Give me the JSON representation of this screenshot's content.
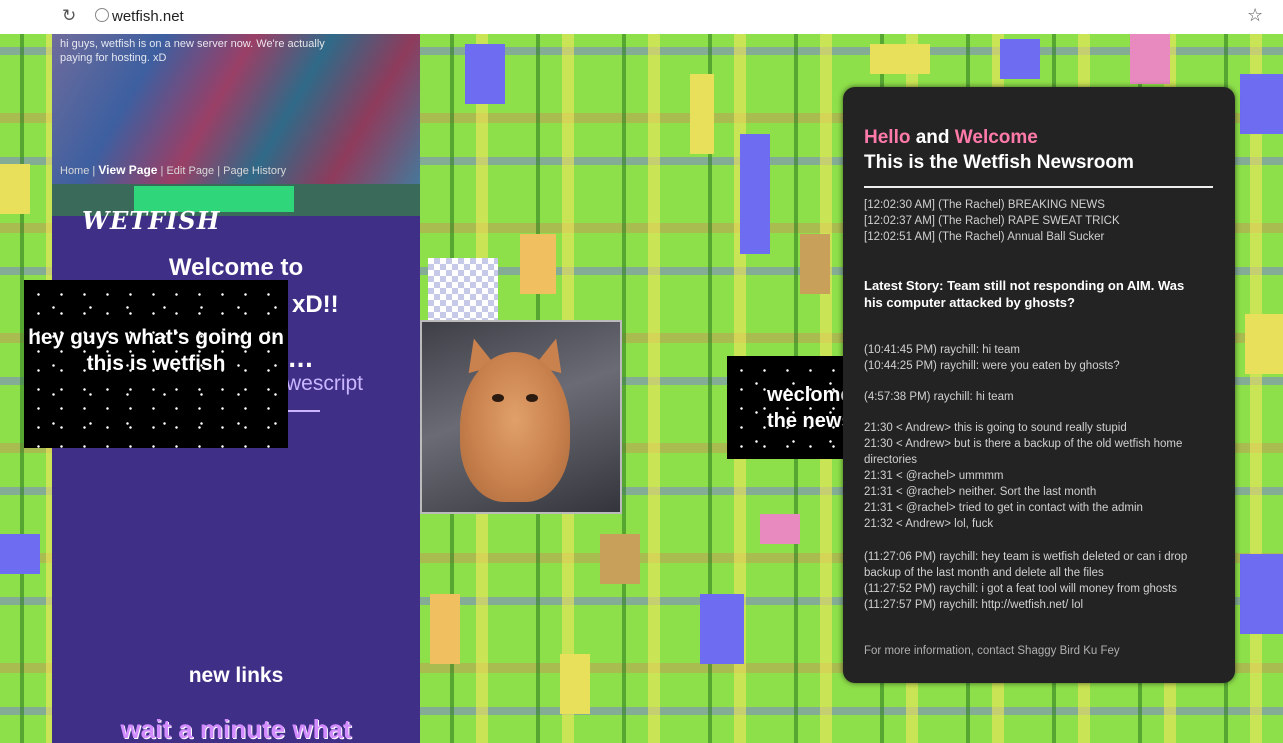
{
  "browser": {
    "url": "wetfish.net"
  },
  "left_column": {
    "banner_text": "hi guys, wetfish is on a new server now. We're actually paying for hosting. xD",
    "wiki_tabs": {
      "home": "Home",
      "view": "View Page",
      "rest": "Edit Page | Page History"
    },
    "logo_text": "WETFISH",
    "welcome_line1": "Welcome to",
    "welcome_xd": "xD!!",
    "ellipsis": "...",
    "wescript": "wescript",
    "new_links": "new links",
    "wait": "wait a minute what"
  },
  "sparkle_box_1": {
    "text": "hey guys what's going on this is wetfish"
  },
  "sparkle_box_2": {
    "line1": "weclome to",
    "line2": "the newsroom"
  },
  "newsroom": {
    "title_hello": "Hello",
    "title_and": " and ",
    "title_welcome": "Welcome",
    "title_line2": "This is the Wetfish Newsroom",
    "breaking": [
      "[12:02:30 AM] (The Rachel) BREAKING NEWS",
      "[12:02:37 AM] (The Rachel) RAPE SWEAT TRICK",
      "[12:02:51 AM] (The Rachel) Annual Ball Sucker"
    ],
    "latest_story": "Latest Story: Team still not responding on AIM. Was his computer attacked by ghosts?",
    "chat_a": [
      "(10:41:45 PM) raychill: hi team",
      "(10:44:25 PM) raychill: were you eaten by ghosts?"
    ],
    "chat_b": [
      "(4:57:38 PM) raychill: hi team"
    ],
    "chat_c": [
      "21:30 < Andrew> this is going to sound really stupid",
      "21:30 < Andrew> but is there a backup of the old wetfish home directories",
      "21:31 < @rachel> ummmm",
      "21:31 < @rachel> neither. Sort the last month",
      "21:31 < @rachel> tried to get in contact with the admin",
      "21:32 < Andrew> lol, fuck"
    ],
    "chat_d": [
      "(11:27:06 PM) raychill: hey team is wetfish deleted or can i drop backup of the last month and delete all the files",
      "(11:27:52 PM) raychill: i got a feat tool will money from ghosts",
      "(11:27:57 PM) raychill: http://wetfish.net/ lol"
    ],
    "footer": "For more information, contact Shaggy Bird Ku Fey"
  }
}
